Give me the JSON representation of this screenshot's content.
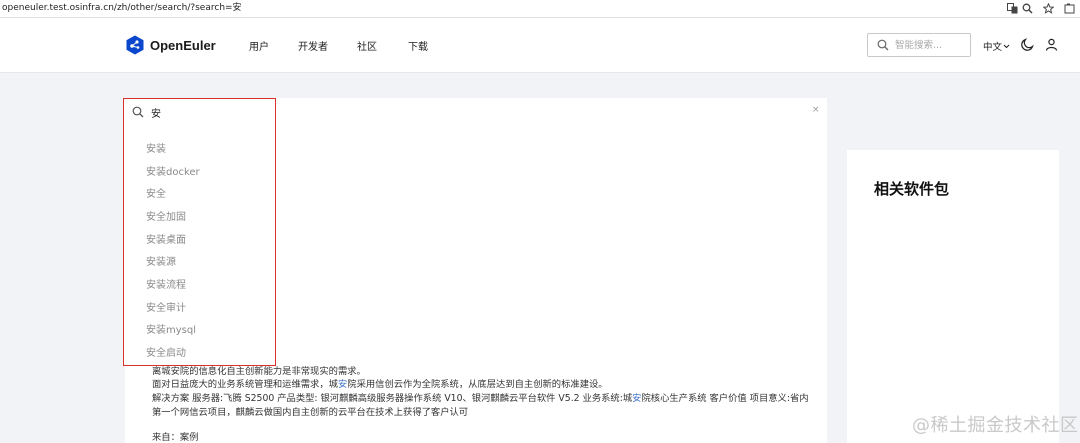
{
  "browser": {
    "url": "openeuler.test.osinfra.cn/zh/other/search/?search=安",
    "icons": [
      "translate-icon",
      "zoom-icon",
      "star-icon",
      "extensions-icon"
    ]
  },
  "header": {
    "brand": "OpenEuler",
    "nav": [
      "用户",
      "开发者",
      "社区",
      "下载"
    ],
    "search_placeholder": "智能搜索...",
    "language": "中文",
    "brand_color": "#0a47cc"
  },
  "search_panel": {
    "query": "安",
    "clear": "×",
    "suggestions": [
      "安装",
      "安装docker",
      "安全",
      "安全加固",
      "安装桌面",
      "安装源",
      "安装流程",
      "安全审计",
      "安装mysql",
      "安全启动"
    ],
    "highlight_color": "#d9312b"
  },
  "result": {
    "line1": "离城安院的信息化自主创新能力是非常现实的需求。",
    "line2_pre": "面对日益庞大的业务系统管理和运维需求，城",
    "line2_hl": "安",
    "line2_post": "院采用信创云作为全院系统，从底层达到自主创新的标准建设。",
    "line3_pre": "解决方案 服务器:飞腾 S2500 产品类型: 银河麒麟高级服务器操作系统 V10、银河麒麟云平台软件 V5.2 业务系统:城",
    "line3_hl": "安",
    "line3_post": "院核心生产系统 客户价值 项目意义:省内",
    "line4": "第一个网信云项目，麒麟云做国内自主创新的云平台在技术上获得了客户认可",
    "source": "来自：案例"
  },
  "sidebar": {
    "title": "相关软件包"
  },
  "watermark": "@稀土掘金技术社区"
}
